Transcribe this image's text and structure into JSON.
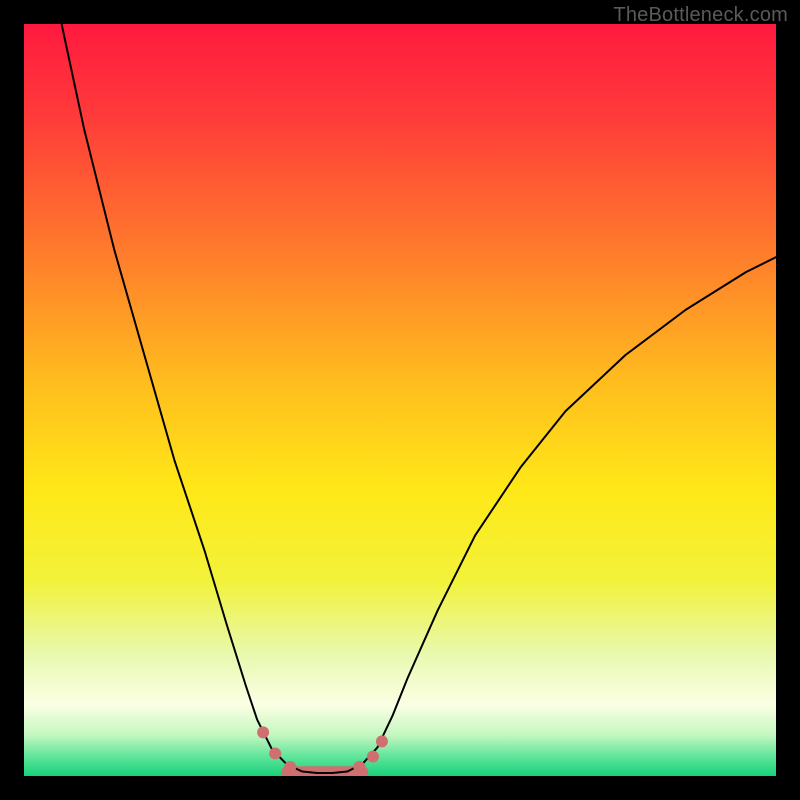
{
  "watermark": "TheBottleneck.com",
  "chart_data": {
    "type": "line",
    "title": "",
    "xlabel": "",
    "ylabel": "",
    "xlim": [
      0,
      100
    ],
    "ylim": [
      0,
      100
    ],
    "grid": false,
    "background_gradient_stops": [
      {
        "offset": 0.0,
        "color": "#ff1a3e"
      },
      {
        "offset": 0.12,
        "color": "#ff3a3a"
      },
      {
        "offset": 0.3,
        "color": "#ff7a2c"
      },
      {
        "offset": 0.48,
        "color": "#ffbe1e"
      },
      {
        "offset": 0.62,
        "color": "#ffe818"
      },
      {
        "offset": 0.74,
        "color": "#f2f23a"
      },
      {
        "offset": 0.84,
        "color": "#e8f9b0"
      },
      {
        "offset": 0.905,
        "color": "#fbffe4"
      },
      {
        "offset": 0.945,
        "color": "#c5f7c0"
      },
      {
        "offset": 0.975,
        "color": "#5de49a"
      },
      {
        "offset": 1.0,
        "color": "#18d17a"
      }
    ],
    "series": [
      {
        "name": "curve",
        "stroke": "#000000",
        "stroke_width": 2,
        "points": [
          {
            "x": 5.0,
            "y": 100.0
          },
          {
            "x": 8.0,
            "y": 86.0
          },
          {
            "x": 12.0,
            "y": 70.0
          },
          {
            "x": 16.0,
            "y": 56.0
          },
          {
            "x": 20.0,
            "y": 42.0
          },
          {
            "x": 24.0,
            "y": 30.0
          },
          {
            "x": 27.0,
            "y": 20.0
          },
          {
            "x": 29.5,
            "y": 12.0
          },
          {
            "x": 31.0,
            "y": 7.5
          },
          {
            "x": 33.0,
            "y": 3.5
          },
          {
            "x": 35.0,
            "y": 1.5
          },
          {
            "x": 37.0,
            "y": 0.6
          },
          {
            "x": 39.0,
            "y": 0.4
          },
          {
            "x": 41.0,
            "y": 0.4
          },
          {
            "x": 43.0,
            "y": 0.6
          },
          {
            "x": 45.0,
            "y": 1.6
          },
          {
            "x": 47.0,
            "y": 3.8
          },
          {
            "x": 49.0,
            "y": 8.0
          },
          {
            "x": 51.0,
            "y": 13.0
          },
          {
            "x": 55.0,
            "y": 22.0
          },
          {
            "x": 60.0,
            "y": 32.0
          },
          {
            "x": 66.0,
            "y": 41.0
          },
          {
            "x": 72.0,
            "y": 48.5
          },
          {
            "x": 80.0,
            "y": 56.0
          },
          {
            "x": 88.0,
            "y": 62.0
          },
          {
            "x": 96.0,
            "y": 67.0
          },
          {
            "x": 100.0,
            "y": 69.0
          }
        ]
      }
    ],
    "markers": [
      {
        "x": 31.8,
        "y": 5.8,
        "r": 6,
        "fill": "#cf6f6f"
      },
      {
        "x": 33.4,
        "y": 3.0,
        "r": 6,
        "fill": "#cf6f6f"
      },
      {
        "x": 35.4,
        "y": 1.2,
        "r": 6,
        "fill": "#cf6f6f"
      },
      {
        "x": 44.6,
        "y": 1.2,
        "r": 6,
        "fill": "#cf6f6f"
      },
      {
        "x": 46.4,
        "y": 2.6,
        "r": 6,
        "fill": "#cf6f6f"
      },
      {
        "x": 47.6,
        "y": 4.6,
        "r": 6,
        "fill": "#cf6f6f"
      }
    ],
    "trough_band": {
      "x_start": 35.0,
      "x_end": 45.0,
      "y": 0.5,
      "stroke": "#cf6f6f",
      "stroke_width": 12
    }
  }
}
